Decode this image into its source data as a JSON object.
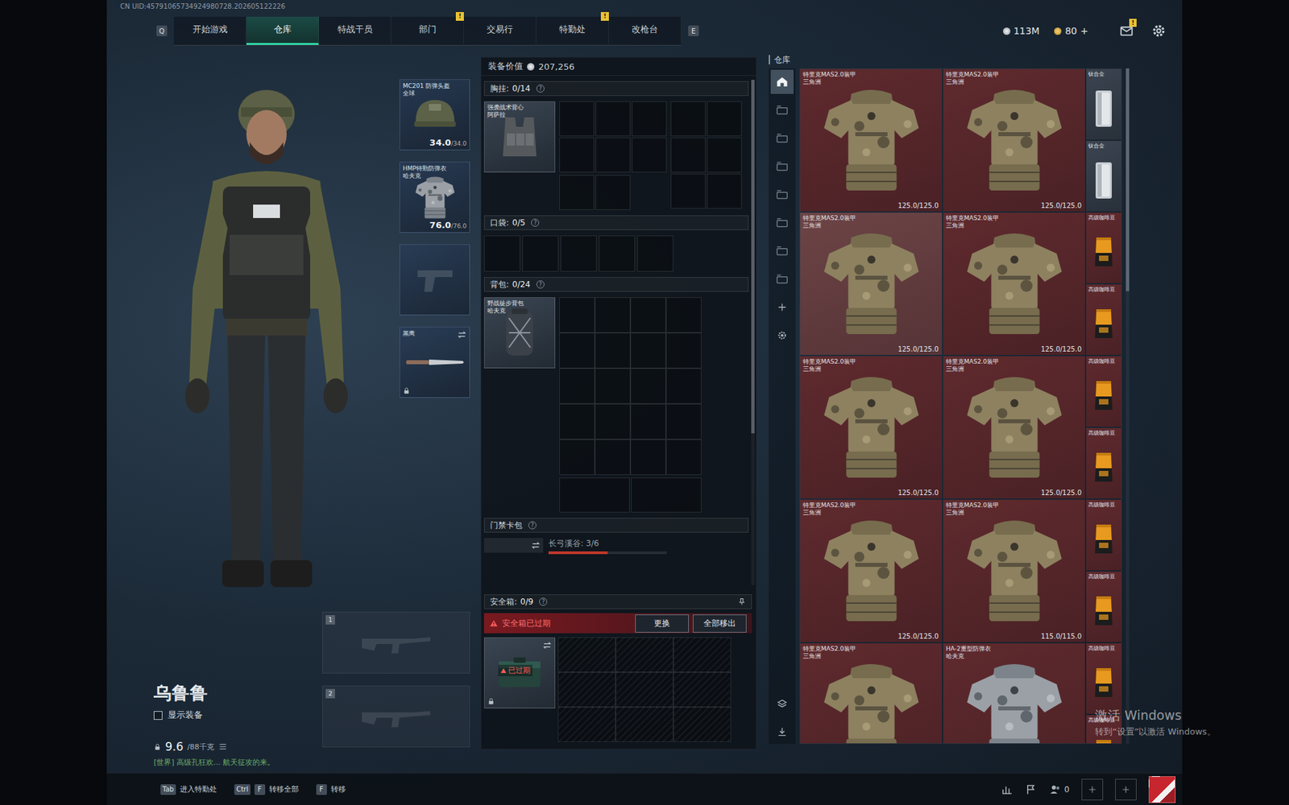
{
  "uid": "CN UID:45791065734924980728.202605122226",
  "nav": {
    "prev_key": "Q",
    "next_key": "E",
    "tabs": [
      {
        "label": "开始游戏",
        "selected": false,
        "badge": ""
      },
      {
        "label": "仓库",
        "selected": true,
        "badge": ""
      },
      {
        "label": "特战干员",
        "selected": false,
        "badge": ""
      },
      {
        "label": "部门",
        "selected": false,
        "badge": "!"
      },
      {
        "label": "交易行",
        "selected": false,
        "badge": ""
      },
      {
        "label": "特勤处",
        "selected": false,
        "badge": "!"
      },
      {
        "label": "改枪台",
        "selected": false,
        "badge": ""
      }
    ]
  },
  "currencies": [
    {
      "kind": "silver",
      "value": "113M",
      "add": ""
    },
    {
      "kind": "gold",
      "value": "80",
      "add": "+"
    }
  ],
  "mail_badge": "!",
  "character": {
    "name": "乌鲁鲁",
    "show_gear": {
      "label": "显示装备",
      "checked": false
    },
    "weight": "9.6",
    "weight_max": "/88千克",
    "chat": "[世界] 高级孔狂欢... 航天征攻的来。"
  },
  "gear_slots": [
    {
      "kind": "helmet",
      "name": "MC201 防弹头盔",
      "sub": "全球",
      "value": "34.0",
      "max": "/34.0",
      "locked": false,
      "swap": false
    },
    {
      "kind": "armor",
      "name": "HMP特勤防弹衣",
      "sub": "哈夫克",
      "value": "76.0",
      "max": "/76.0",
      "locked": false,
      "swap": false
    },
    {
      "kind": "pistol",
      "name": "",
      "sub": "",
      "value": "",
      "max": "",
      "locked": false,
      "swap": false
    },
    {
      "kind": "melee",
      "name": "黑鹰",
      "sub": "",
      "value": "",
      "max": "",
      "locked": true,
      "swap": true
    }
  ],
  "weapon_slots": [
    {
      "number": "1"
    },
    {
      "number": "2"
    }
  ],
  "loadout": {
    "value_label": "装备价值",
    "value": "207,256",
    "rig": {
      "label": "胸挂:",
      "count": "0/14",
      "help": "?",
      "item": "强袭战术背心",
      "item_sub": "阿萨拉"
    },
    "pocket": {
      "label": "口袋:",
      "count": "0/5",
      "help": "?"
    },
    "backpack": {
      "label": "背包:",
      "count": "0/24",
      "help": "?",
      "item": "野战徒步背包",
      "item_sub": "哈夫克"
    },
    "keycard": {
      "label": "门禁卡包",
      "help": "?",
      "entry": "长弓溪谷: 3/6",
      "level": 0.5
    },
    "safe": {
      "label": "安全箱:",
      "count": "0/9",
      "help": "?",
      "warning": "安全箱已过期",
      "expired": true,
      "expired_label": "已过期",
      "buttons": [
        "更换",
        "全部移出"
      ]
    }
  },
  "warehouse": {
    "title": "仓库",
    "sidebar": [
      {
        "kind": "home",
        "selected": true
      },
      {
        "kind": "level",
        "selected": false
      },
      {
        "kind": "level",
        "selected": false
      },
      {
        "kind": "level",
        "selected": false
      },
      {
        "kind": "level",
        "selected": false
      },
      {
        "kind": "level",
        "selected": false
      },
      {
        "kind": "level",
        "selected": false
      },
      {
        "kind": "level",
        "selected": false
      },
      {
        "kind": "add",
        "selected": false
      },
      {
        "kind": "settings",
        "selected": false
      }
    ],
    "sidebar_bottom": [
      {
        "kind": "layers"
      },
      {
        "kind": "transfer"
      }
    ],
    "items": [
      {
        "name": "特里克MAS2.0装甲",
        "sub": "三角洲",
        "durability": "125.0/125.0",
        "kind": "camo",
        "highlighted": false
      },
      {
        "name": "特里克MAS2.0装甲",
        "sub": "三角洲",
        "durability": "125.0/125.0",
        "kind": "camo",
        "highlighted": false
      },
      {
        "name": "特里克MAS2.0装甲",
        "sub": "三角洲",
        "durability": "125.0/125.0",
        "kind": "camo",
        "highlighted": true
      },
      {
        "name": "特里克MAS2.0装甲",
        "sub": "三角洲",
        "durability": "125.0/125.0",
        "kind": "camo",
        "highlighted": false
      },
      {
        "name": "特里克MAS2.0装甲",
        "sub": "三角洲",
        "durability": "125.0/125.0",
        "kind": "camo",
        "highlighted": false
      },
      {
        "name": "特里克MAS2.0装甲",
        "sub": "三角洲",
        "durability": "125.0/125.0",
        "kind": "camo",
        "highlighted": false
      },
      {
        "name": "特里克MAS2.0装甲",
        "sub": "三角洲",
        "durability": "125.0/125.0",
        "kind": "camo",
        "highlighted": false
      },
      {
        "name": "特里克MAS2.0装甲",
        "sub": "三角洲",
        "durability": "115.0/115.0",
        "kind": "camo",
        "highlighted": false
      },
      {
        "name": "特里克MAS2.0装甲",
        "sub": "三角洲",
        "durability": "",
        "kind": "camo",
        "highlighted": false
      },
      {
        "name": "HA-2重型防弹衣",
        "sub": "哈夫克",
        "durability": "",
        "kind": "grey",
        "highlighted": false
      }
    ],
    "side_items": [
      {
        "name": "钛合金",
        "kind": "plate"
      },
      {
        "name": "钛合金",
        "kind": "plate"
      },
      {
        "name": "高级咖啡豆",
        "kind": "coffee"
      },
      {
        "name": "高级咖啡豆",
        "kind": "coffee"
      },
      {
        "name": "高级咖啡豆",
        "kind": "coffee"
      },
      {
        "name": "高级咖啡豆",
        "kind": "coffee"
      },
      {
        "name": "高级咖啡豆",
        "kind": "coffee"
      },
      {
        "name": "高级咖啡豆",
        "kind": "coffee"
      },
      {
        "name": "高级咖啡豆",
        "kind": "coffee"
      },
      {
        "name": "高级咖啡豆",
        "kind": "coffee"
      }
    ]
  },
  "hints": [
    {
      "keys": [
        "Tab"
      ],
      "label": "进入特勤处"
    },
    {
      "keys": [
        "Ctrl",
        "F"
      ],
      "label": "转移全部"
    },
    {
      "keys": [
        "F"
      ],
      "label": "转移"
    }
  ],
  "social": {
    "friends": "0"
  },
  "watermark": {
    "title": "激活 Windows",
    "sub": "转到“设置”以激活 Windows。"
  }
}
